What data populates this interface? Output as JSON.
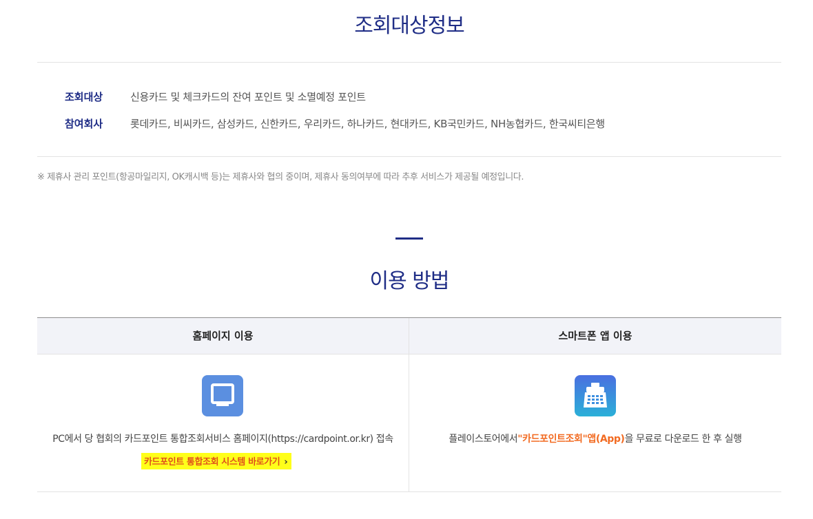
{
  "target_info": {
    "title": "조회대상정보",
    "rows": [
      {
        "label": "조회대상",
        "value": "신용카드 및 체크카드의 잔여 포인트 및 소멸예정 포인트"
      },
      {
        "label": "참여회사",
        "value": "롯데카드, 비씨카드, 삼성카드, 신한카드, 우리카드, 하나카드, 현대카드, KB국민카드, NH농협카드, 한국씨티은행"
      }
    ],
    "note": "※ 제휴사 관리 포인트(항공마일리지, OK캐시백 등)는 제휴사와 협의 중이며, 제휴사 동의여부에 따라 추후 서비스가 제공될 예정입니다."
  },
  "usage": {
    "title": "이용 방법",
    "homepage": {
      "header": "홈페이지 이용",
      "icon": "monitor-icon",
      "description": "PC에서 당 협회의 카드포인트 통합조회서비스 홈페이지(https://cardpoint.or.kr) 접속",
      "link_label": "카드포인트 통합조회 시스템 바로가기",
      "link_chevron": "›"
    },
    "app": {
      "header": "스마트폰 앱 이용",
      "icon": "card-terminal-icon",
      "desc_prefix": "플레이스토어에서",
      "desc_highlight": "\"카드포인트조회\"앱(App)",
      "desc_suffix": "을 무료로 다운로드 한 후 실행"
    }
  },
  "colors": {
    "primary": "#1f2d86",
    "highlight": "#f26b22",
    "link_bg": "#ffff1a"
  }
}
